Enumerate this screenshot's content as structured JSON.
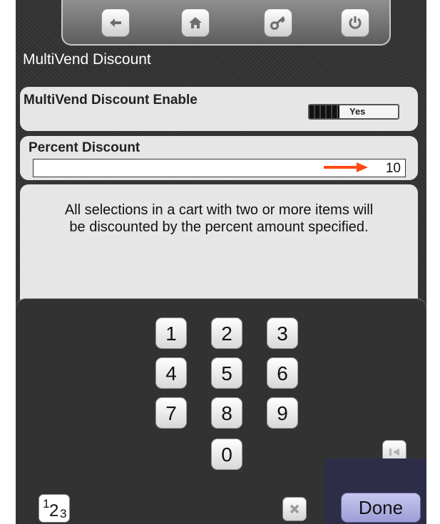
{
  "page_title": "MultiVend Discount",
  "nav_icons": [
    "back-arrow-icon",
    "home-icon",
    "key-icon",
    "power-icon"
  ],
  "settings": {
    "enable": {
      "label": "MultiVend Discount Enable",
      "value": "Yes"
    },
    "percent": {
      "label": "Percent Discount",
      "value": "10"
    },
    "description": "All selections in a cart with two or more items will be discounted by the percent amount specified."
  },
  "keypad": {
    "keys": [
      "1",
      "2",
      "3",
      "4",
      "5",
      "6",
      "7",
      "8",
      "9",
      "0"
    ],
    "mode_label": {
      "sup": "1",
      "big": "2",
      "sub": "3"
    },
    "done_label": "Done",
    "icons": [
      "clear-icon",
      "backspace-icon"
    ]
  },
  "colors": {
    "arrow": "#ff4a12",
    "done_button": "#b4b4e6",
    "panel": "#e6e6e6"
  }
}
